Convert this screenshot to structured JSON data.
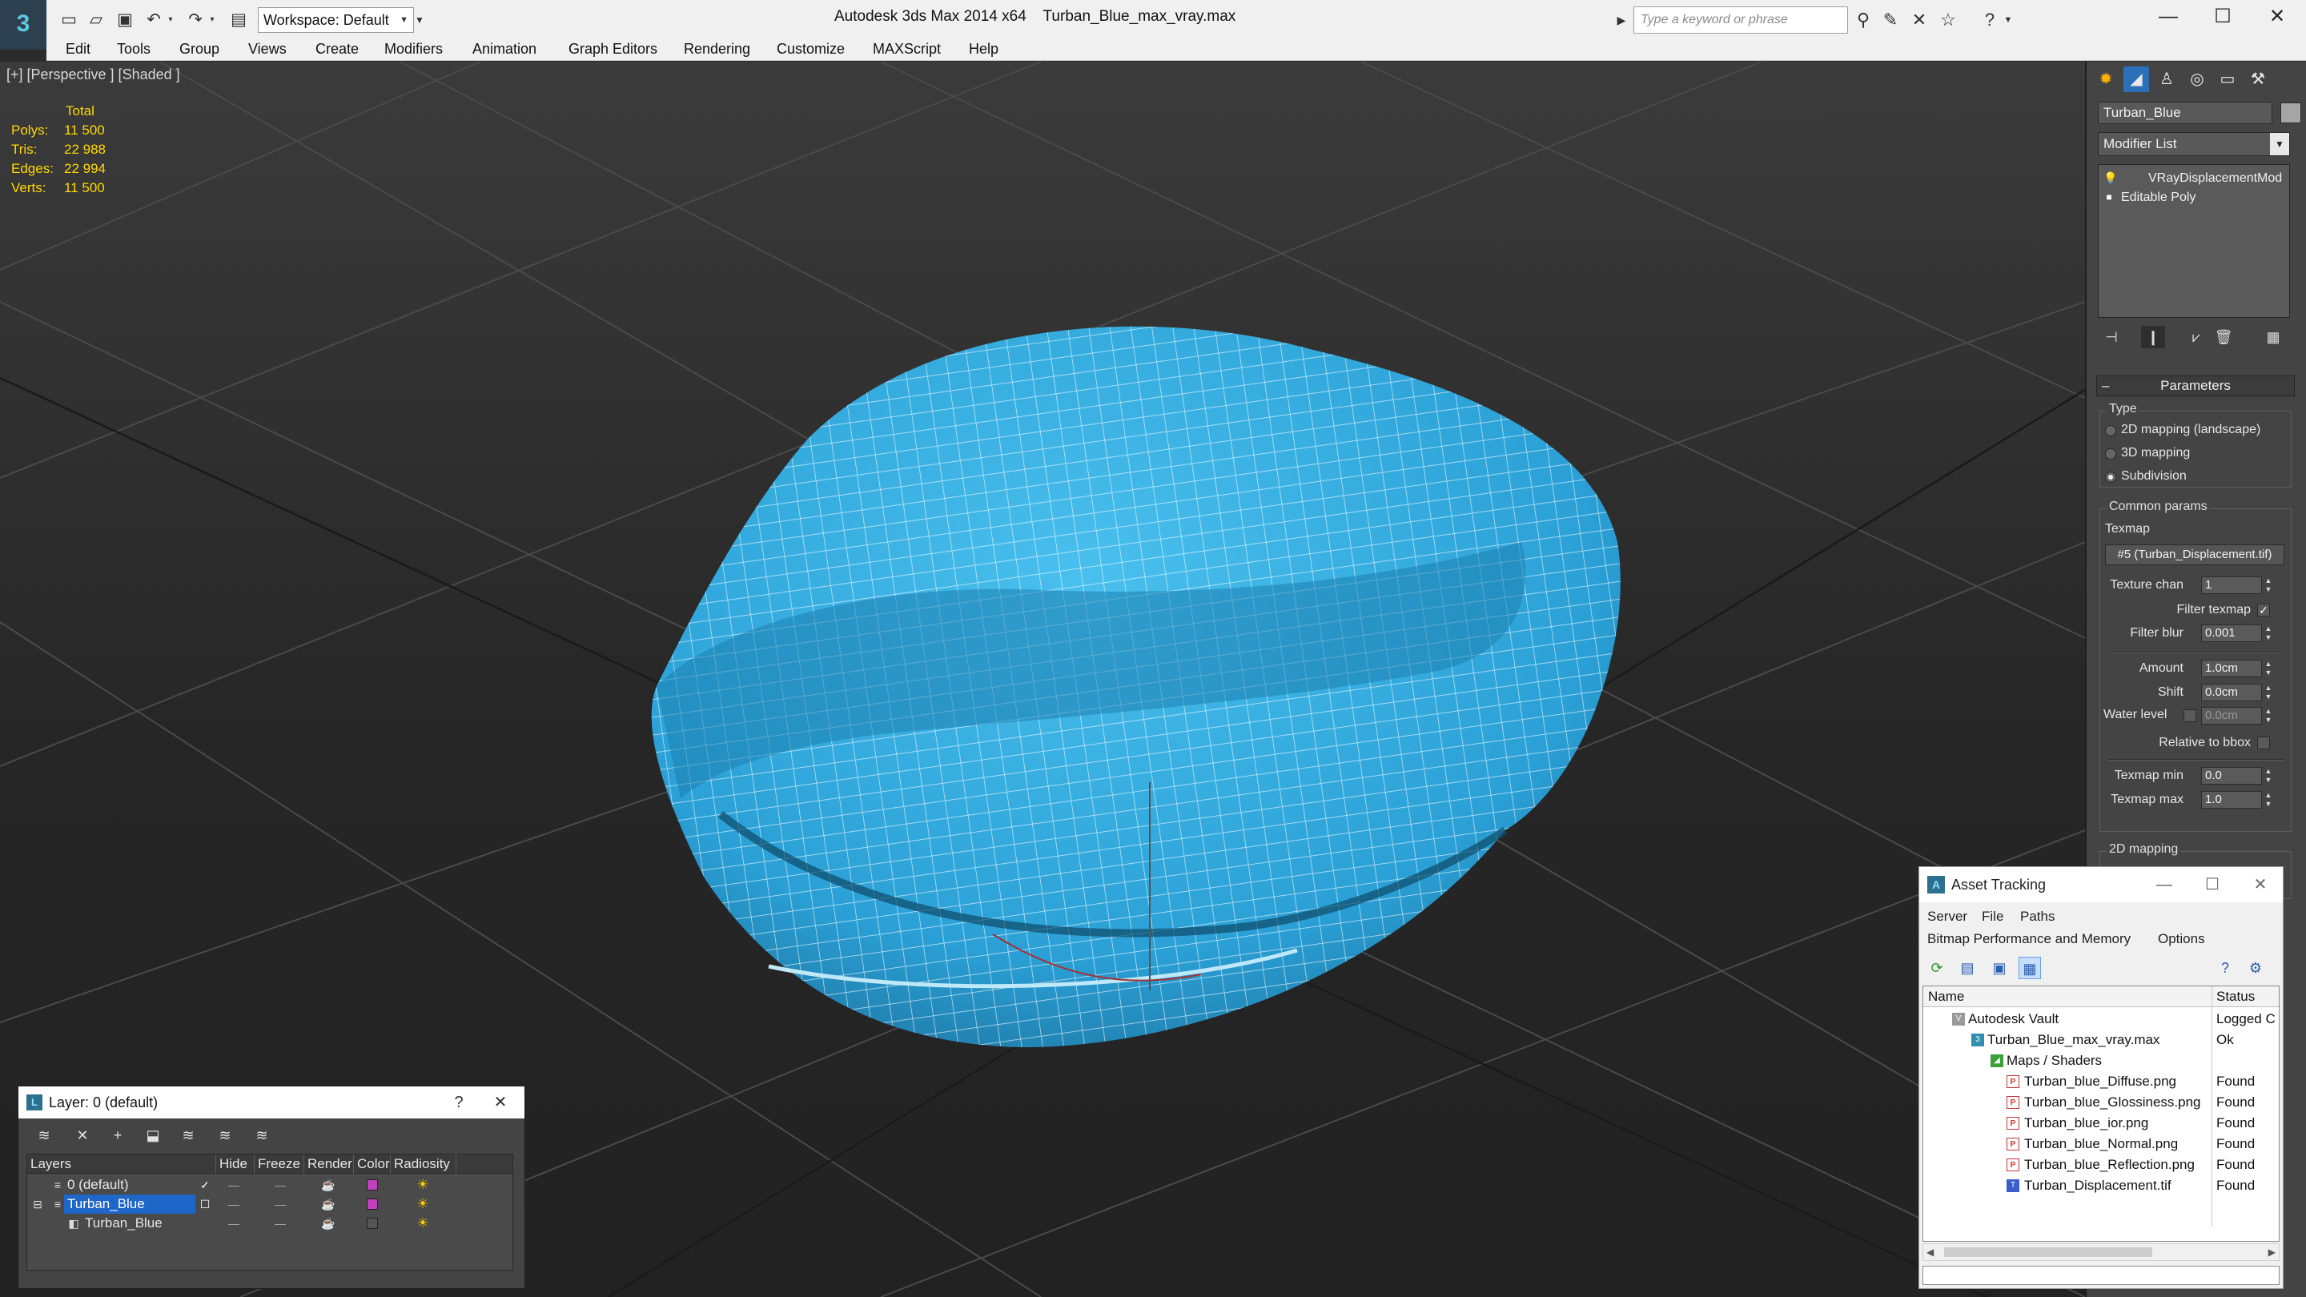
{
  "app": {
    "title": "Autodesk 3ds Max 2014 x64    Turban_Blue_max_vray.max",
    "logo_icon": "3ds-max-logo-icon",
    "workspace": "Workspace: Default",
    "search_placeholder": "Type a keyword or phrase"
  },
  "menu": [
    "Edit",
    "Tools",
    "Group",
    "Views",
    "Create",
    "Modifiers",
    "Animation",
    "Graph Editors",
    "Rendering",
    "Customize",
    "MAXScript",
    "Help"
  ],
  "viewport": {
    "label": "[+] [Perspective ] [Shaded ]",
    "stats": {
      "header": "Total",
      "rows": [
        {
          "key": "Polys:",
          "value": "11 500"
        },
        {
          "key": "Tris:",
          "value": "22 988"
        },
        {
          "key": "Edges:",
          "value": "22 994"
        },
        {
          "key": "Verts:",
          "value": "11 500"
        }
      ]
    },
    "object_color": "#3fb0e0"
  },
  "command_panel": {
    "object_name": "Turban_Blue",
    "modifier_list": "Modifier List",
    "stack": [
      "VRayDisplacementMod",
      "Editable Poly"
    ],
    "rollout_title": "Parameters",
    "type_group": "Type",
    "type_options": [
      {
        "label": "2D mapping (landscape)",
        "selected": false
      },
      {
        "label": "3D mapping",
        "selected": false
      },
      {
        "label": "Subdivision",
        "selected": true
      }
    ],
    "common_group": "Common params",
    "texmap_label": "Texmap",
    "texmap_value": "#5 (Turban_Displacement.tif)",
    "texture_chan_label": "Texture chan",
    "texture_chan": "1",
    "filter_texmap_label": "Filter texmap",
    "filter_blur_label": "Filter blur",
    "filter_blur": "0.001",
    "amount_label": "Amount",
    "amount": "1.0cm",
    "shift_label": "Shift",
    "shift": "0.0cm",
    "water_level_label": "Water level",
    "water_level": "0.0cm",
    "relative_label": "Relative to bbox",
    "texmap_min_label": "Texmap min",
    "texmap_min": "0.0",
    "texmap_max_label": "Texmap max",
    "texmap_max": "1.0",
    "mapping_group": "2D mapping"
  },
  "asset_tracking": {
    "title": "Asset Tracking",
    "menu1": [
      "Server",
      "File",
      "Paths"
    ],
    "menu2": [
      "Bitmap Performance and Memory",
      "Options"
    ],
    "col_name": "Name",
    "col_status": "Status",
    "rows": [
      {
        "name": "Autodesk Vault",
        "status": "Logged C",
        "icon": "vault"
      },
      {
        "name": "Turban_Blue_max_vray.max",
        "status": "Ok",
        "icon": "max"
      },
      {
        "name": "Maps / Shaders",
        "status": "",
        "icon": "maps"
      },
      {
        "name": "Turban_blue_Diffuse.png",
        "status": "Found",
        "icon": "png"
      },
      {
        "name": "Turban_blue_Glossiness.png",
        "status": "Found",
        "icon": "png"
      },
      {
        "name": "Turban_blue_ior.png",
        "status": "Found",
        "icon": "png"
      },
      {
        "name": "Turban_blue_Normal.png",
        "status": "Found",
        "icon": "png"
      },
      {
        "name": "Turban_blue_Reflection.png",
        "status": "Found",
        "icon": "png"
      },
      {
        "name": "Turban_Displacement.tif",
        "status": "Found",
        "icon": "tif"
      }
    ]
  },
  "layer_dialog": {
    "title": "Layer: 0 (default)",
    "columns": [
      "Layers",
      "Hide",
      "Freeze",
      "Render",
      "Color",
      "Radiosity"
    ],
    "rows": [
      {
        "name": "0 (default)",
        "color": "#c040c0",
        "selected": false
      },
      {
        "name": "Turban_Blue",
        "color": "#c040c0",
        "selected": true
      },
      {
        "name": "Turban_Blue",
        "color": "#555555",
        "selected": false
      }
    ]
  }
}
